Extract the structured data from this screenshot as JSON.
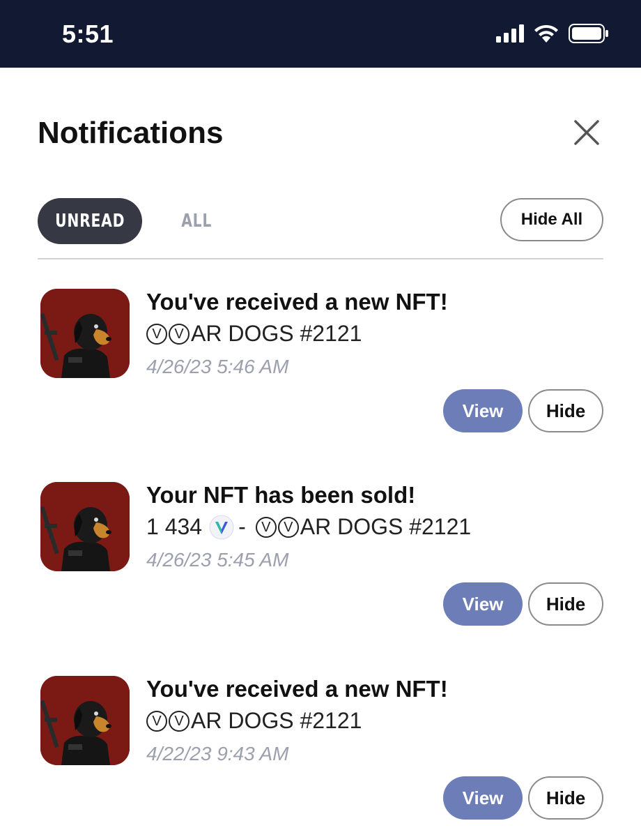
{
  "status_bar": {
    "time": "5:51"
  },
  "header": {
    "title": "Notifications"
  },
  "tabs": [
    {
      "label": "UNREAD",
      "active": true
    },
    {
      "label": "ALL",
      "active": false
    }
  ],
  "hide_all_label": "Hide All",
  "notifications": [
    {
      "title": "You've received a new NFT!",
      "body_name": "AR DOGS #2121",
      "time": "4/26/23 5:46 AM",
      "view_label": "View",
      "hide_label": "Hide"
    },
    {
      "title": "Your NFT has been sold!",
      "price": "1 434",
      "separator": "-",
      "body_name": "AR DOGS #2121",
      "time": "4/26/23 5:45 AM",
      "view_label": "View",
      "hide_label": "Hide"
    },
    {
      "title": "You've received a new NFT!",
      "body_name": "AR DOGS #2121",
      "time": "4/22/23 9:43 AM",
      "view_label": "View",
      "hide_label": "Hide"
    }
  ],
  "circled_letter": "V",
  "colors": {
    "status_bar": "#121a33",
    "tab_active": "#363943",
    "view_button": "#6c7db8",
    "avatar_bg": "#7b1a14",
    "timestamp": "#9ca0ad"
  },
  "icons": [
    "signal-icon",
    "wifi-icon",
    "battery-icon",
    "close-icon",
    "vet-token-icon"
  ]
}
